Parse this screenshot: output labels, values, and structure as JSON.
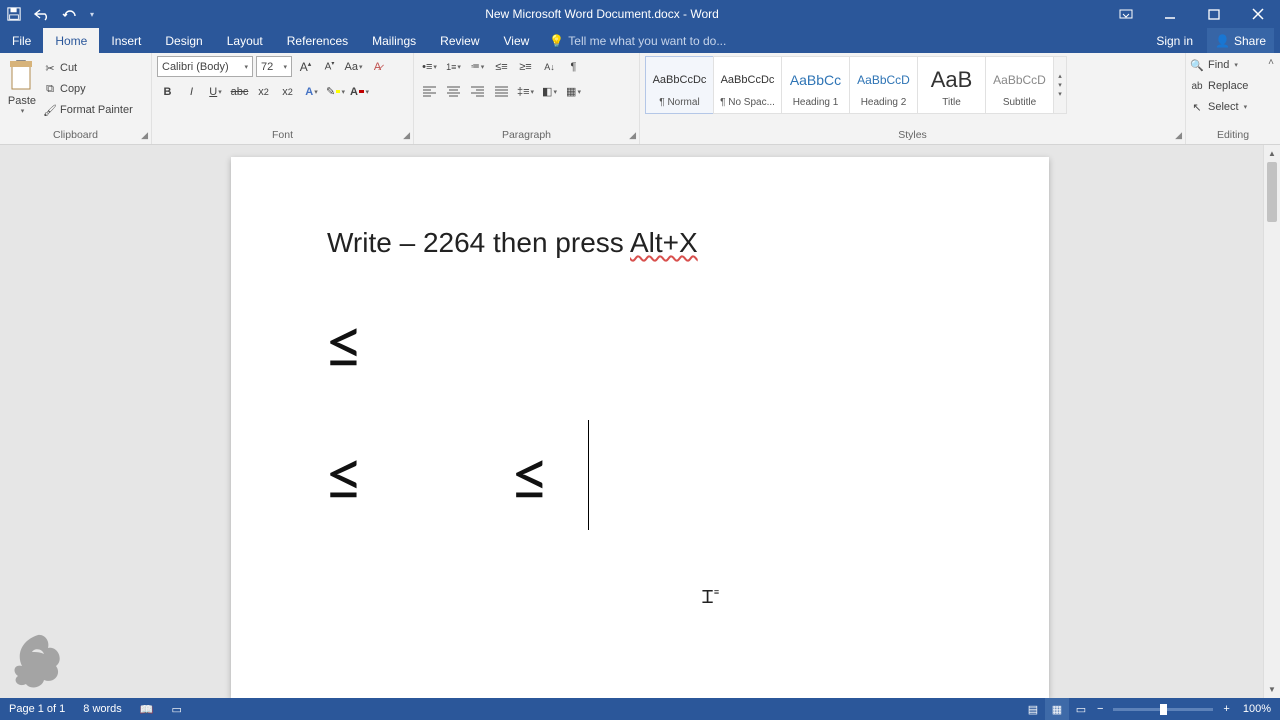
{
  "app": {
    "title": "New Microsoft Word Document.docx - Word"
  },
  "tabs": {
    "file": "File",
    "home": "Home",
    "insert": "Insert",
    "design": "Design",
    "layout": "Layout",
    "references": "References",
    "mailings": "Mailings",
    "review": "Review",
    "view": "View",
    "tellme": "Tell me what you want to do...",
    "signin": "Sign in",
    "share": "Share"
  },
  "clipboard": {
    "paste": "Paste",
    "cut": "Cut",
    "copy": "Copy",
    "fmtpainter": "Format Painter",
    "group": "Clipboard"
  },
  "font": {
    "name": "Calibri (Body)",
    "size": "72",
    "group": "Font"
  },
  "paragraph": {
    "group": "Paragraph"
  },
  "styles": {
    "group": "Styles",
    "list": [
      {
        "sample": "AaBbCcDc",
        "name": "¶ Normal",
        "selected": true,
        "sampleColor": "#333",
        "sampleSize": "11px"
      },
      {
        "sample": "AaBbCcDc",
        "name": "¶ No Spac...",
        "selected": false,
        "sampleColor": "#333",
        "sampleSize": "11px"
      },
      {
        "sample": "AaBbCc",
        "name": "Heading 1",
        "selected": false,
        "sampleColor": "#2e74b5",
        "sampleSize": "14px"
      },
      {
        "sample": "AaBbCcD",
        "name": "Heading 2",
        "selected": false,
        "sampleColor": "#2e74b5",
        "sampleSize": "12px"
      },
      {
        "sample": "AaB",
        "name": "Title",
        "selected": false,
        "sampleColor": "#333",
        "sampleSize": "22px"
      },
      {
        "sample": "AaBbCcD",
        "name": "Subtitle",
        "selected": false,
        "sampleColor": "#888",
        "sampleSize": "12px"
      }
    ]
  },
  "editing": {
    "find": "Find",
    "replace": "Replace",
    "select": "Select",
    "group": "Editing"
  },
  "doc": {
    "line1a": "Write – 2264 then press ",
    "line1b": "Alt+X",
    "line2": "≤",
    "line3a": "≤",
    "line3b": "≤"
  },
  "status": {
    "page": "Page 1 of 1",
    "words": "8 words",
    "zoom": "100%"
  }
}
